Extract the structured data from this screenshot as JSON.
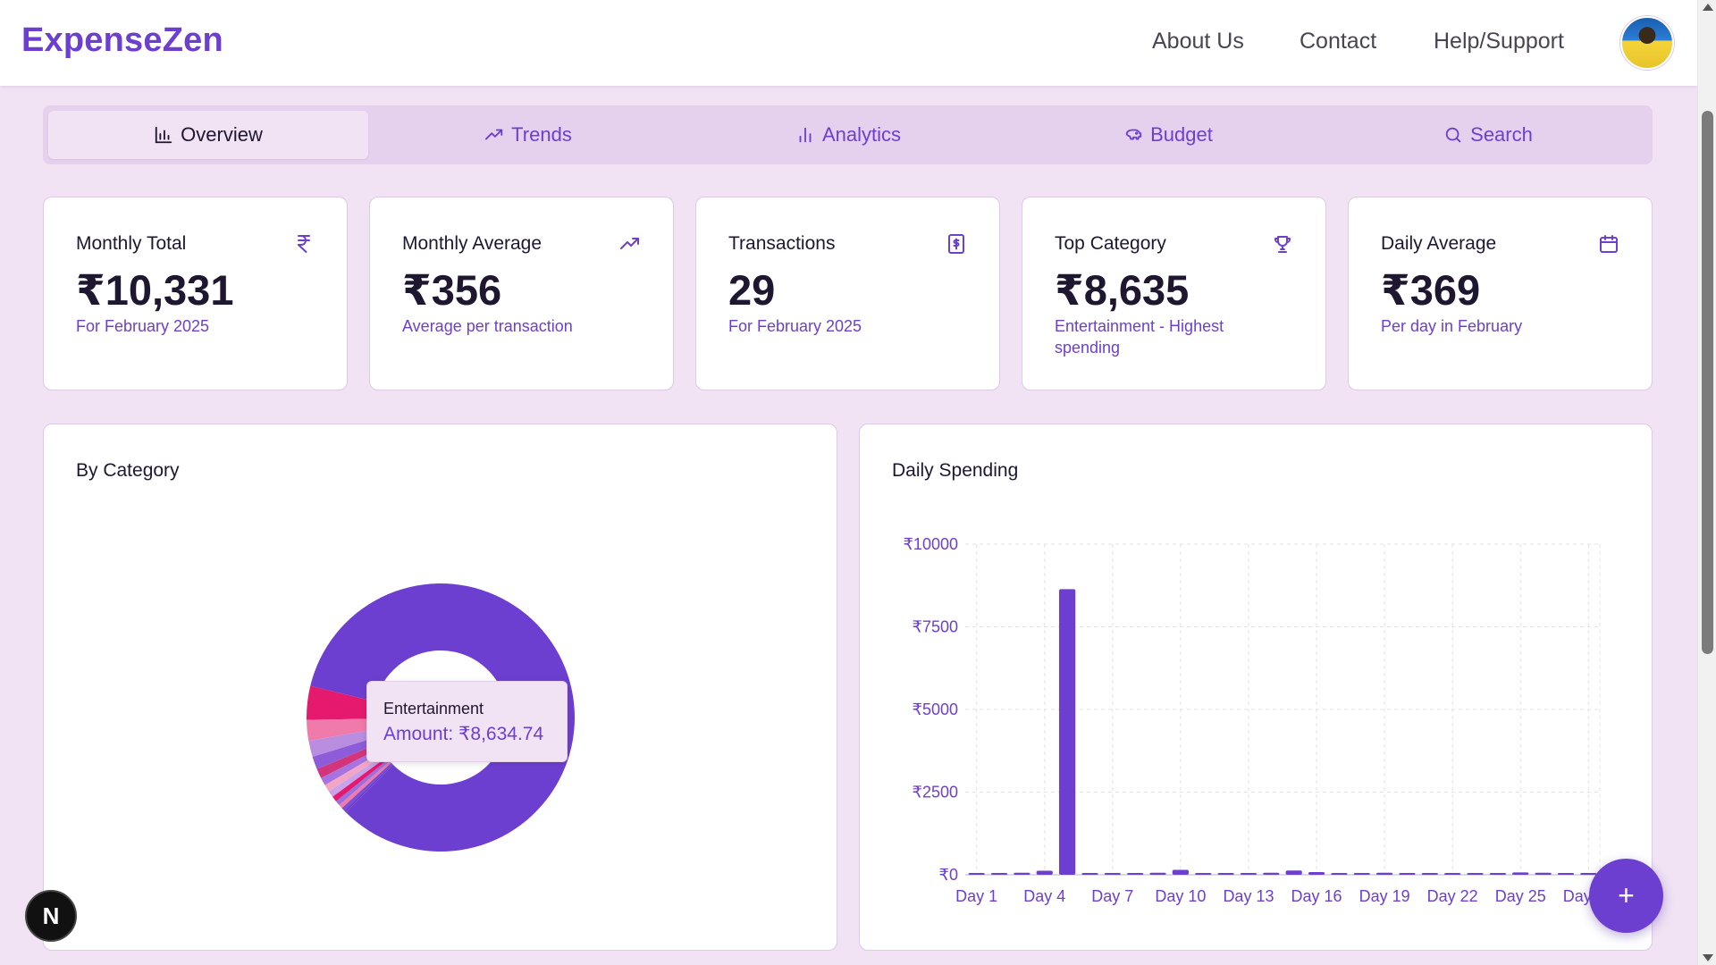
{
  "header": {
    "brand": "ExpenseZen",
    "nav": [
      "About Us",
      "Contact",
      "Help/Support"
    ]
  },
  "tabs": [
    {
      "label": "Overview",
      "icon": "bar-chart-icon",
      "active": true
    },
    {
      "label": "Trends",
      "icon": "trending-up-icon",
      "active": false
    },
    {
      "label": "Analytics",
      "icon": "analytics-icon",
      "active": false
    },
    {
      "label": "Budget",
      "icon": "piggy-bank-icon",
      "active": false
    },
    {
      "label": "Search",
      "icon": "search-icon",
      "active": false
    }
  ],
  "stats": [
    {
      "title": "Monthly Total",
      "value": "₹10,331",
      "sub": "For February 2025",
      "icon": "rupee-icon"
    },
    {
      "title": "Monthly Average",
      "value": "₹356",
      "sub": "Average per transaction",
      "icon": "trending-up-icon"
    },
    {
      "title": "Transactions",
      "value": "29",
      "sub": "For February 2025",
      "icon": "receipt-icon"
    },
    {
      "title": "Top Category",
      "value": "₹8,635",
      "sub": "Entertainment - Highest spending",
      "icon": "trophy-icon"
    },
    {
      "title": "Daily Average",
      "value": "₹369",
      "sub": "Per day in February",
      "icon": "calendar-icon"
    }
  ],
  "category_panel": {
    "title": "By Category",
    "tooltip": {
      "name": "Entertainment",
      "amount": "Amount: ₹8,634.74"
    }
  },
  "daily_panel": {
    "title": "Daily Spending"
  },
  "colors": {
    "accent": "#6d3fd0",
    "background": "#f1e2f4",
    "pink": "#e5196e",
    "light_pink": "#f07aaa",
    "lavender": "#b98ee0"
  },
  "fab": {
    "label": "+"
  },
  "badge": {
    "label": "N"
  },
  "chart_data": [
    {
      "type": "pie",
      "title": "By Category",
      "labels": [
        "Entertainment"
      ],
      "values": [
        8634.74
      ],
      "other_slices_approx": [
        420,
        260,
        200,
        160,
        120,
        100,
        90,
        80,
        70,
        60,
        50,
        40,
        30
      ]
    },
    {
      "type": "bar",
      "title": "Daily Spending",
      "x": [
        "Day 1",
        "Day 2",
        "Day 3",
        "Day 4",
        "Day 5",
        "Day 6",
        "Day 7",
        "Day 8",
        "Day 9",
        "Day 10",
        "Day 11",
        "Day 12",
        "Day 13",
        "Day 14",
        "Day 15",
        "Day 16",
        "Day 17",
        "Day 18",
        "Day 19",
        "Day 20",
        "Day 21",
        "Day 22",
        "Day 23",
        "Day 24",
        "Day 25",
        "Day 26",
        "Day 27",
        "Day 28"
      ],
      "x_tick_labels": [
        "Day 1",
        "Day 4",
        "Day 7",
        "Day 10",
        "Day 13",
        "Day 16",
        "Day 19",
        "Day 22",
        "Day 25",
        "Day 28"
      ],
      "values": [
        20,
        30,
        60,
        120,
        8640,
        10,
        20,
        40,
        60,
        150,
        15,
        50,
        30,
        60,
        130,
        80,
        20,
        40,
        60,
        15,
        30,
        40,
        50,
        20,
        70,
        60,
        20,
        40
      ],
      "y_ticks": [
        "₹0",
        "₹2500",
        "₹5000",
        "₹7500",
        "₹10000"
      ],
      "ylim": [
        0,
        10000
      ],
      "grid": true
    }
  ]
}
